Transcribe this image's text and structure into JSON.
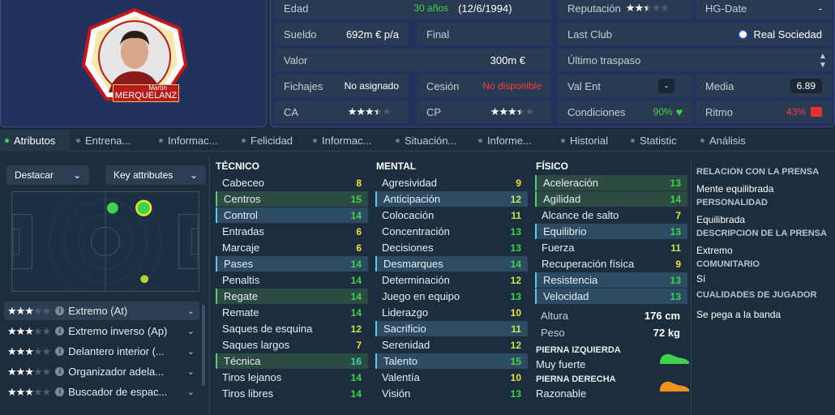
{
  "player": {
    "first_name": "Martín",
    "last_name": "MERQUELANZ"
  },
  "info": {
    "age_label": "Edad",
    "age_value": "30 años",
    "dob": "(12/6/1994)",
    "wage_label": "Sueldo",
    "wage_value": "692m € p/a",
    "contract_label": "Final",
    "value_label": "Valor",
    "value_value": "300m €",
    "transfer_label": "Fichajes",
    "transfer_value": "No asignado",
    "loan_label": "Cesión",
    "loan_value": "No disponible",
    "ca_label": "CA",
    "cp_label": "CP",
    "reputation_label": "Reputación",
    "hg_label": "HG-Date",
    "hg_value": "-",
    "last_club_label": "Last Club",
    "last_club_value": "Real Sociedad",
    "last_transfer_label": "Último traspaso",
    "valent_label": "Val Ent",
    "valent_value": "-",
    "media_label": "Media",
    "media_value": "6.89",
    "condition_label": "Condiciones",
    "condition_value": "90%",
    "ritmo_label": "Ritmo",
    "ritmo_value": "43%"
  },
  "stars": {
    "reputation": 2.5,
    "ca": 3.5,
    "cp": 3.5
  },
  "tabs": [
    {
      "label": "Atributos",
      "active": true
    },
    {
      "label": "Entrena..."
    },
    {
      "label": "Informac..."
    },
    {
      "label": "Felicidad"
    },
    {
      "label": "Informac..."
    },
    {
      "label": "Situación..."
    },
    {
      "label": "Informe..."
    },
    {
      "label": "Historial"
    },
    {
      "label": "Statistic"
    },
    {
      "label": "Análisis"
    }
  ],
  "left": {
    "highlight_label": "Destacar",
    "key_attrs_label": "Key attributes",
    "roles": [
      {
        "stars": 3,
        "label": "Extremo (At)"
      },
      {
        "stars": 3,
        "label": "Extremo inverso (Ap)"
      },
      {
        "stars": 3,
        "label": "Delantero interior (..."
      },
      {
        "stars": 3,
        "label": "Organizador adela..."
      },
      {
        "stars": 3,
        "label": "Buscador de espac..."
      }
    ]
  },
  "technical": {
    "title": "TÉCNICO",
    "items": [
      {
        "name": "Cabeceo",
        "value": "8"
      },
      {
        "name": "Centros",
        "value": "15"
      },
      {
        "name": "Control",
        "value": "14"
      },
      {
        "name": "Entradas",
        "value": "6"
      },
      {
        "name": "Marcaje",
        "value": "6"
      },
      {
        "name": "Pases",
        "value": "14"
      },
      {
        "name": "Penaltis",
        "value": "14"
      },
      {
        "name": "Regate",
        "value": "14"
      },
      {
        "name": "Remate",
        "value": "14"
      },
      {
        "name": "Saques de esquina",
        "value": "12"
      },
      {
        "name": "Saques largos",
        "value": "7"
      },
      {
        "name": "Técnica",
        "value": "16"
      },
      {
        "name": "Tiros lejanos",
        "value": "14"
      },
      {
        "name": "Tiros libres",
        "value": "14"
      }
    ]
  },
  "mental": {
    "title": "MENTAL",
    "items": [
      {
        "name": "Agresividad",
        "value": "9"
      },
      {
        "name": "Anticipación",
        "value": "12"
      },
      {
        "name": "Colocación",
        "value": "11"
      },
      {
        "name": "Concentración",
        "value": "13"
      },
      {
        "name": "Decisiones",
        "value": "13"
      },
      {
        "name": "Desmarques",
        "value": "14"
      },
      {
        "name": "Determinación",
        "value": "12"
      },
      {
        "name": "Juego en equipo",
        "value": "13"
      },
      {
        "name": "Liderazgo",
        "value": "10"
      },
      {
        "name": "Sacrificio",
        "value": "11"
      },
      {
        "name": "Serenidad",
        "value": "12"
      },
      {
        "name": "Talento",
        "value": "15"
      },
      {
        "name": "Valentía",
        "value": "10"
      },
      {
        "name": "Visión",
        "value": "13"
      }
    ]
  },
  "physical": {
    "title": "FÍSICO",
    "items": [
      {
        "name": "Aceleración",
        "value": "13"
      },
      {
        "name": "Agilidad",
        "value": "14"
      },
      {
        "name": "Alcance de salto",
        "value": "7"
      },
      {
        "name": "Equilibrio",
        "value": "13"
      },
      {
        "name": "Fuerza",
        "value": "11"
      },
      {
        "name": "Recuperación física",
        "value": "9"
      },
      {
        "name": "Resistencia",
        "value": "13"
      },
      {
        "name": "Velocidad",
        "value": "13"
      }
    ],
    "height_label": "Altura",
    "height_value": "176 cm",
    "weight_label": "Peso",
    "weight_value": "72 kg",
    "left_foot_label": "PIERNA IZQUIERDA",
    "left_foot_value": "Muy fuerte",
    "right_foot_label": "PIERNA DERECHA",
    "right_foot_value": "Razonable"
  },
  "side": {
    "relation_label": "RELACIÓN CON LA PRENSA",
    "relation_value": "Mente equilibrada",
    "personality_label": "PERSONALIDAD",
    "personality_value": "Equilibrada",
    "description_label": "DESCRIPCIÓN DE LA PRENSA",
    "description_value": "Extremo",
    "community_label": "COMUNITARIO",
    "community_value": "Sí",
    "qualities_label": "CUALIDADES DE JUGADOR",
    "qualities_value": "Se pega a la banda"
  },
  "colors": {
    "background": "#1c2d3d",
    "panel": "#22325d",
    "accent_green": "#3ed44a",
    "accent_blue": "#5fc7f0",
    "alert_red": "#ff3b3b"
  }
}
